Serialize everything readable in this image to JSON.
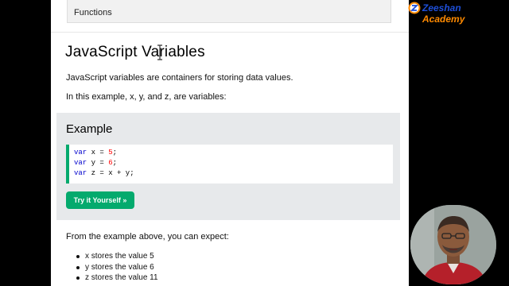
{
  "nav": {
    "item_label": "Functions"
  },
  "page_title": "JavaScript Variables",
  "intro": "JavaScript variables are containers for storing data values.",
  "example_intro": "In this example, x, y, and z, are variables:",
  "example": {
    "title": "Example",
    "code_lines": [
      {
        "keyword": "var",
        "rest": " x = ",
        "value": "5",
        "end": ";"
      },
      {
        "keyword": "var",
        "rest": " y = ",
        "value": "6",
        "end": ";"
      },
      {
        "keyword": "var",
        "rest": " z = x + y;",
        "value": "",
        "end": ""
      }
    ],
    "button_label": "Try it Yourself »"
  },
  "expectation": "From the example above, you can expect:",
  "bullets": [
    "x stores the value 5",
    "y stores the value 6",
    "z stores the value 11"
  ],
  "logo": {
    "part1": "Zeeshan",
    "part2": "Academy"
  },
  "colors": {
    "accent": "#04aa6d",
    "example_bg": "#e7e9eb",
    "keyword": "#0000cd",
    "number": "#ff0000"
  },
  "icons": [
    "text-cursor-icon",
    "logo-icon"
  ]
}
